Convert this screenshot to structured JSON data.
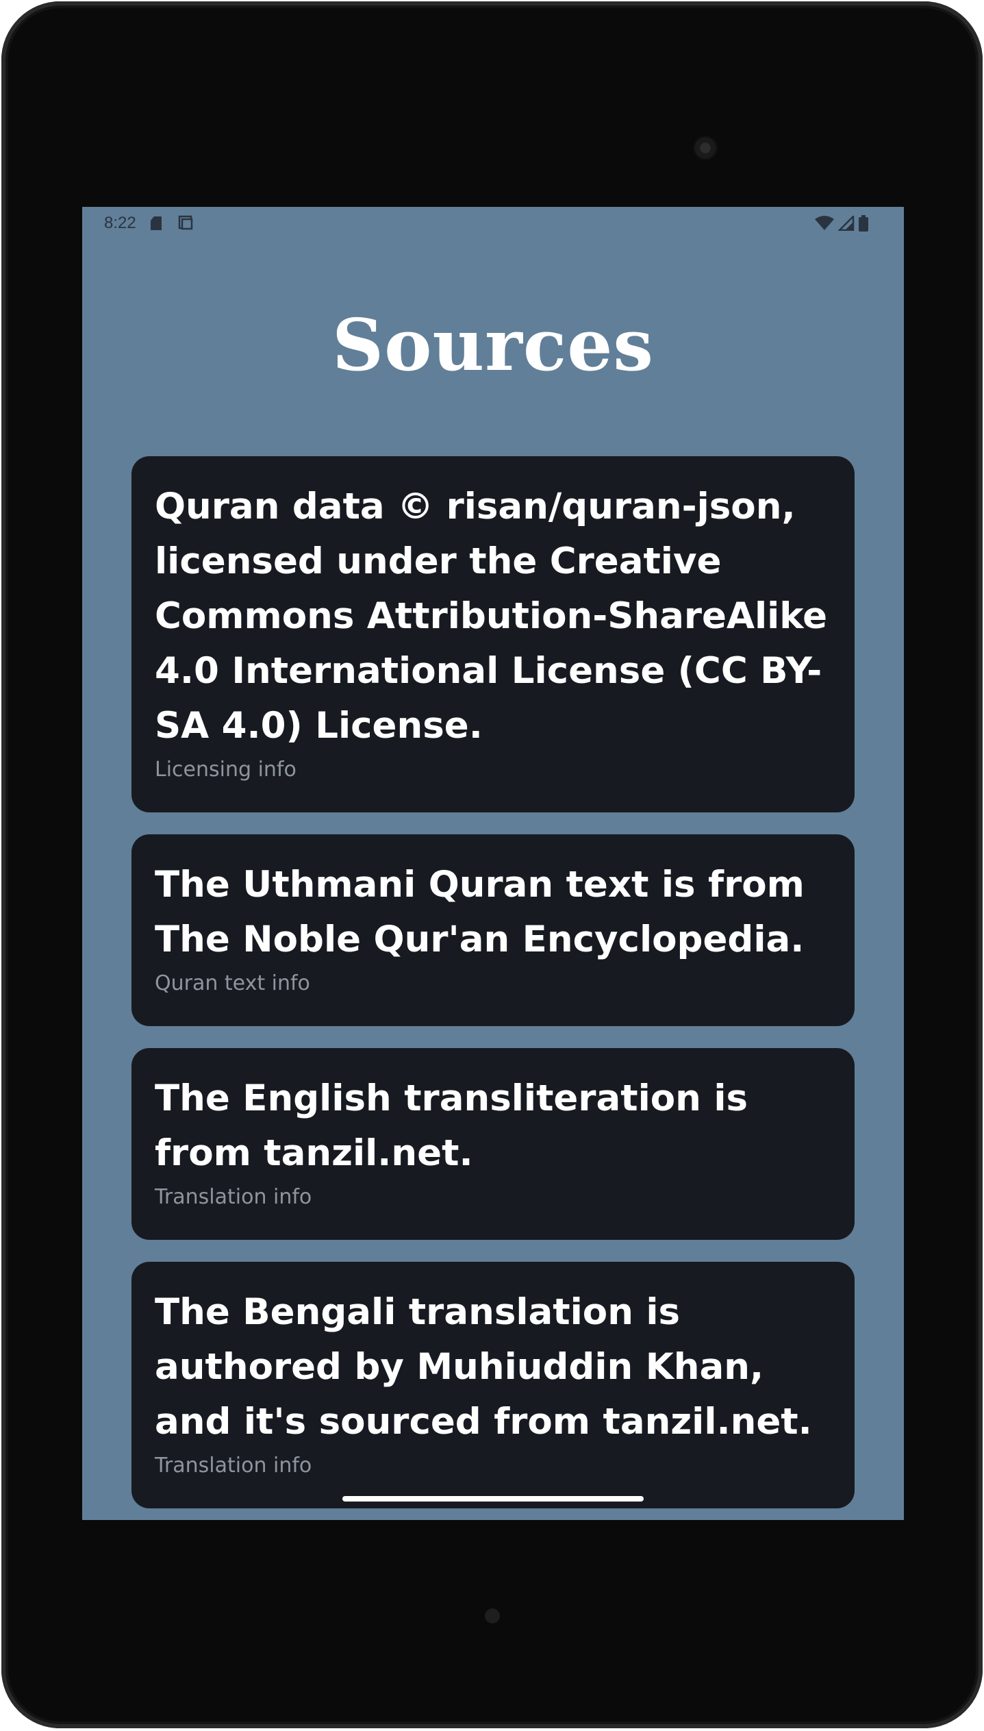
{
  "statusbar": {
    "time": "8:22",
    "icons_left": [
      "sd-card-icon",
      "screenshot-icon"
    ],
    "icons_right": [
      "wifi-icon",
      "cellular-signal-icon",
      "battery-icon"
    ]
  },
  "page": {
    "title": "Sources"
  },
  "cards": [
    {
      "text": "Quran data © risan/quran-json, licensed under the Creative Commons Attribution-ShareAlike 4.0 International License (CC BY-SA 4.0) License.",
      "subtitle": "Licensing info"
    },
    {
      "text": "The Uthmani Quran text is from The Noble Qur'an Encyclopedia.",
      "subtitle": "Quran text info"
    },
    {
      "text": "The English transliteration is from tanzil.net.",
      "subtitle": "Translation info"
    },
    {
      "text": "The Bengali translation is authored by Muhiuddin Khan, and it's sourced from tanzil.net.",
      "subtitle": "Translation info"
    }
  ],
  "colors": {
    "background": "#617f98",
    "card": "#171b21",
    "card_text": "#ffffff",
    "card_subtitle": "#8f959c"
  }
}
